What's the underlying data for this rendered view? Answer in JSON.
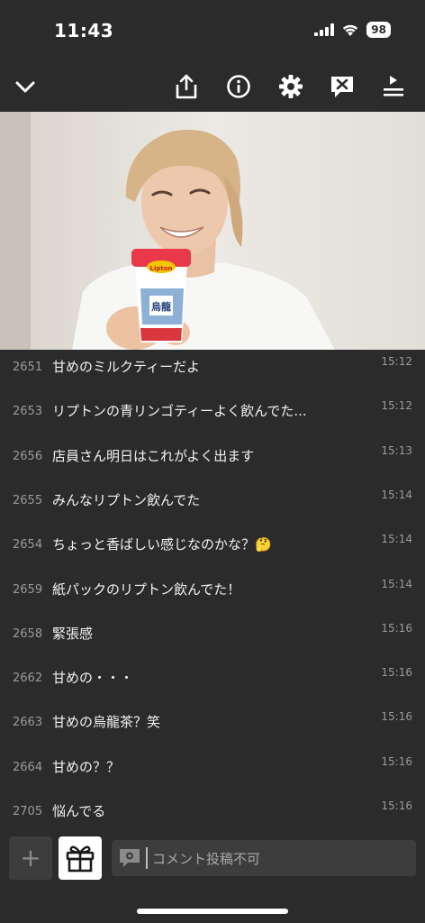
{
  "status_bar": {
    "time": "11:43",
    "battery": "98"
  },
  "toolbar": {
    "icons": [
      "chevron-down-icon",
      "share-icon",
      "info-icon",
      "gear-icon",
      "comment-off-icon",
      "playlist-icon"
    ]
  },
  "comments": [
    {
      "num": "2651",
      "text": "甘めのミルクティーだよ",
      "time": "15:12"
    },
    {
      "num": "2653",
      "text": "リプトンの青リンゴティーよく飲んでた...",
      "time": "15:12"
    },
    {
      "num": "2656",
      "text": "店員さん明日はこれがよく出ます",
      "time": "15:13"
    },
    {
      "num": "2655",
      "text": "みんなリプトン飲んでた",
      "time": "15:14"
    },
    {
      "num": "2654",
      "text": "ちょっと香ばしい感じなのかな？🤔",
      "time": "15:14"
    },
    {
      "num": "2659",
      "text": "紙パックのリプトン飲んでた！",
      "time": "15:14"
    },
    {
      "num": "2658",
      "text": "緊張感",
      "time": "15:16"
    },
    {
      "num": "2662",
      "text": "甘めの・・・",
      "time": "15:16"
    },
    {
      "num": "2663",
      "text": "甘めの烏龍茶？笑",
      "time": "15:16"
    },
    {
      "num": "2664",
      "text": "甘めの？？",
      "time": "15:16"
    },
    {
      "num": "2705",
      "text": "悩んでる",
      "time": "15:16"
    }
  ],
  "bottom": {
    "plus_label": "+",
    "input_placeholder": "コメント投稿不可"
  },
  "video_product": {
    "brand": "Lipton",
    "label": "烏龍"
  },
  "colors": {
    "background": "#2b2b2b",
    "input": "#3d3d3d",
    "muted": "#9a9a9a"
  }
}
